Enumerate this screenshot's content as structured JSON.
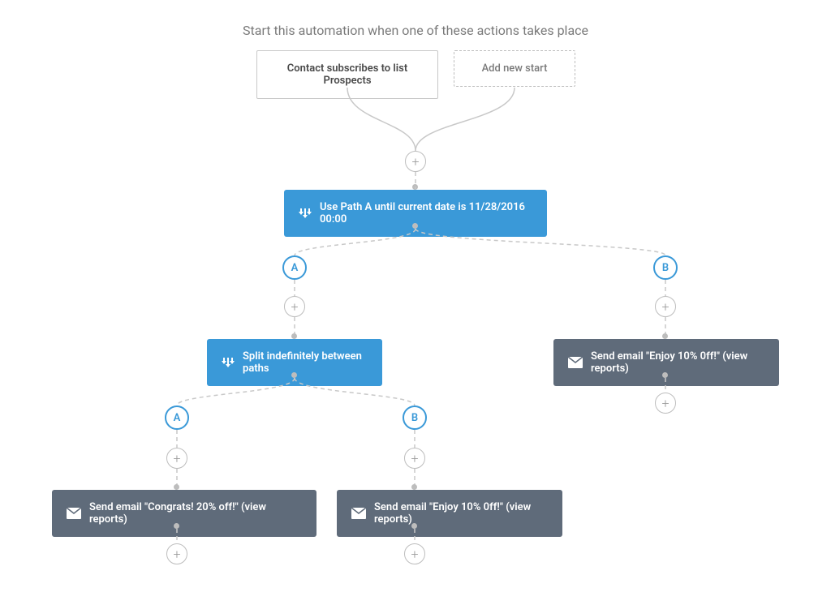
{
  "header": "Start this automation when one of these actions takes place",
  "start": {
    "trigger": "Contact subscribes to list Prospects",
    "add_new": "Add new start"
  },
  "nodes": {
    "split_date": "Use Path A until current date is 11/28/2016 00:00",
    "split_indef": "Split indefinitely between paths",
    "email_congrats": "Send email \"Congrats! 20% off!\" (view reports)",
    "email_enjoy_left": "Send email \"Enjoy 10% 0ff!\" (view reports)",
    "email_enjoy_right": "Send email \"Enjoy 10% 0ff!\" (view reports)"
  },
  "badges": {
    "a": "A",
    "b": "B"
  },
  "plus": "+"
}
